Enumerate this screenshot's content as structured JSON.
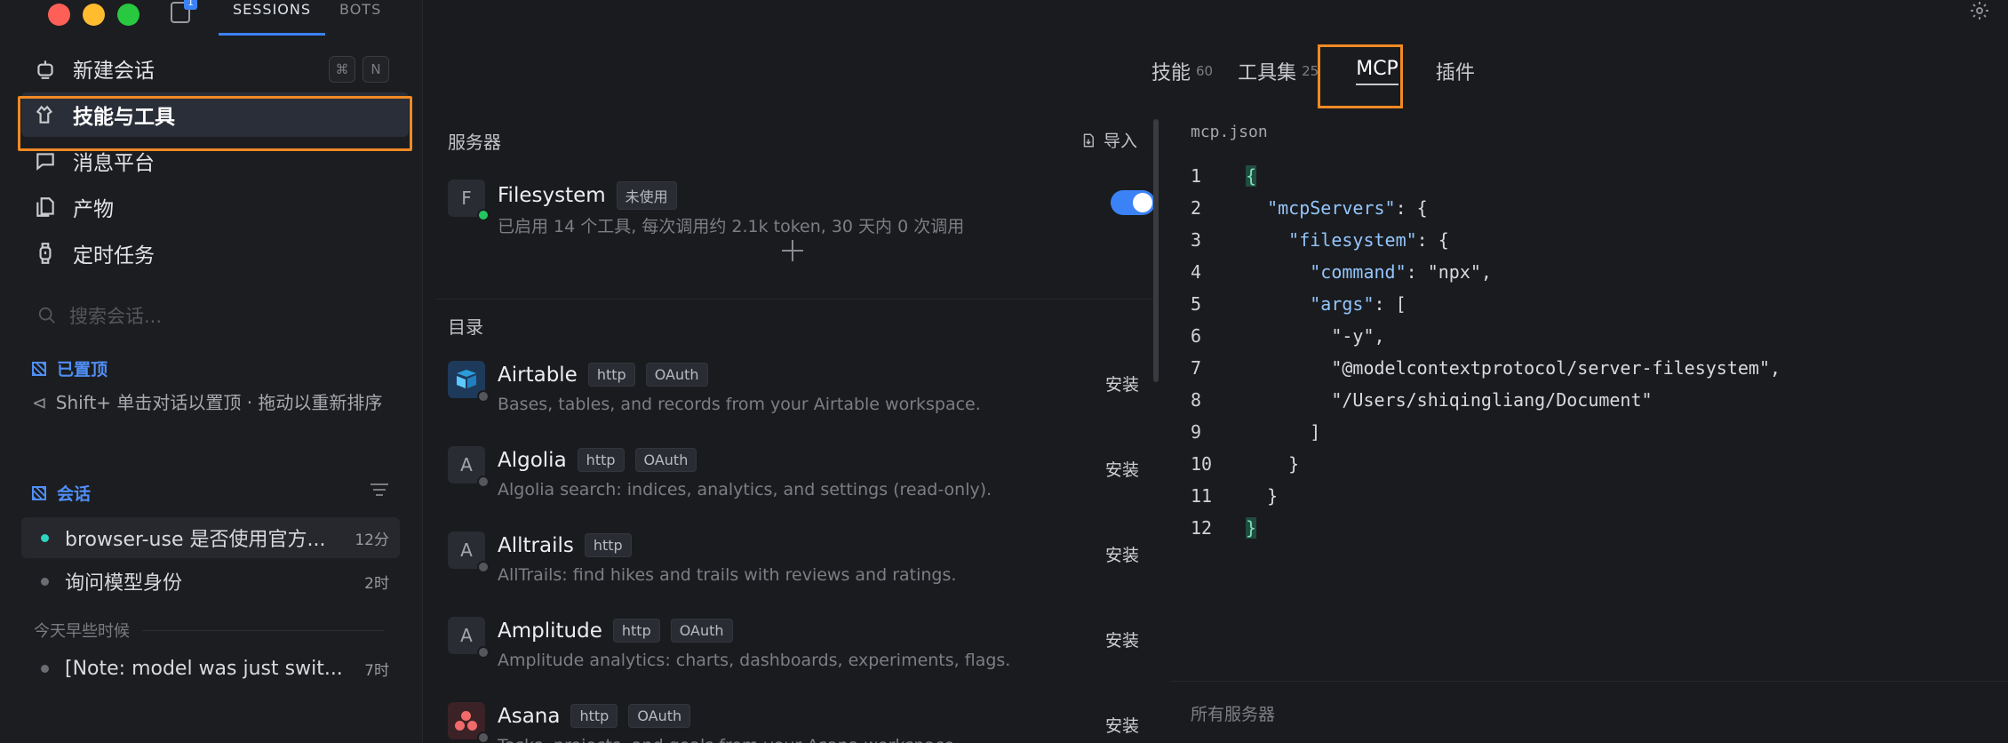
{
  "window": {
    "badge_count": "1"
  },
  "top_tabs": [
    "SESSIONS",
    "BOTS"
  ],
  "sidebar": {
    "new_chat": "新建会话",
    "kbd_cmd": "⌘",
    "kbd_n": "N",
    "nav": [
      {
        "label": "技能与工具",
        "icon": "skills-tools-icon"
      },
      {
        "label": "消息平台",
        "icon": "chat-bubble-icon"
      },
      {
        "label": "产物",
        "icon": "documents-icon"
      },
      {
        "label": "定时任务",
        "icon": "watch-icon"
      }
    ],
    "search_placeholder": "搜索会话...",
    "pinned_title": "已置顶",
    "pinned_hint": "Shift+ 单击对话以置顶 · 拖动以重新排序",
    "conversations_title": "会话",
    "conversations": [
      {
        "title": "browser-use 是否使用官方...",
        "time": "12分"
      },
      {
        "title": "询问模型身份",
        "time": "2时"
      }
    ],
    "earlier_label": "今天早些时候",
    "earlier": [
      {
        "title": "[Note: model was just swit...",
        "time": "7时"
      }
    ]
  },
  "main_tabs": [
    {
      "label": "技能",
      "count": "60"
    },
    {
      "label": "工具集",
      "count": "25"
    },
    {
      "label": "MCP",
      "count": ""
    },
    {
      "label": "插件",
      "count": ""
    }
  ],
  "servers": {
    "title": "服务器",
    "import_label": "导入",
    "installed": [
      {
        "avatar": "F",
        "name": "Filesystem",
        "tag": "未使用",
        "desc": "已启用 14 个工具, 每次调用约 2.1k token, 30 天内 0 次调用",
        "enabled": true
      }
    ]
  },
  "catalog": {
    "title": "目录",
    "install_label": "安装",
    "items": [
      {
        "avatar": "airtable",
        "name": "Airtable",
        "tags": [
          "http",
          "OAuth"
        ],
        "desc": "Bases, tables, and records from your Airtable workspace."
      },
      {
        "avatar": "A",
        "name": "Algolia",
        "tags": [
          "http",
          "OAuth"
        ],
        "desc": "Algolia search: indices, analytics, and settings (read-only)."
      },
      {
        "avatar": "A",
        "name": "Alltrails",
        "tags": [
          "http"
        ],
        "desc": "AllTrails: find hikes and trails with reviews and ratings."
      },
      {
        "avatar": "A",
        "name": "Amplitude",
        "tags": [
          "http",
          "OAuth"
        ],
        "desc": "Amplitude analytics: charts, dashboards, experiments, flags."
      },
      {
        "avatar": "asana",
        "name": "Asana",
        "tags": [
          "http",
          "OAuth"
        ],
        "desc": "Tasks, projects, and goals from your Asana workspace."
      }
    ]
  },
  "editor": {
    "filename": "mcp.json",
    "lines": [
      "{",
      "  \"mcpServers\": {",
      "    \"filesystem\": {",
      "      \"command\": \"npx\",",
      "      \"args\": [",
      "        \"-y\",",
      "        \"@modelcontextprotocol/server-filesystem\",",
      "        \"/Users/shiqingliang/Document\"",
      "      ]",
      "    }",
      "  }",
      "}"
    ],
    "footer": "所有服务器"
  },
  "colors": {
    "accent": "#3b82f6",
    "highlight": "#f08a24",
    "online": "#22c55e"
  }
}
